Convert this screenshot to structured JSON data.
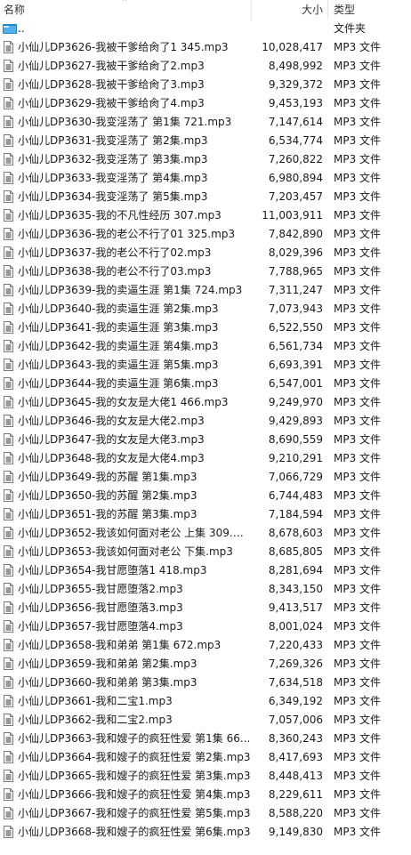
{
  "columns": {
    "name": "名称",
    "size": "大小",
    "type": "类型"
  },
  "parent": {
    "name": "..",
    "type": "文件夹",
    "icon": "folder-up-icon"
  },
  "file_icon": "mp3-file-icon",
  "files": [
    {
      "name": "小仙儿DP3626-我被干爹给肏了1 345.mp3",
      "size": "10,028,417",
      "type": "MP3 文件"
    },
    {
      "name": "小仙儿DP3627-我被干爹给肏了2.mp3",
      "size": "8,498,992",
      "type": "MP3 文件"
    },
    {
      "name": "小仙儿DP3628-我被干爹给肏了3.mp3",
      "size": "9,329,372",
      "type": "MP3 文件"
    },
    {
      "name": "小仙儿DP3629-我被干爹给肏了4.mp3",
      "size": "9,453,193",
      "type": "MP3 文件"
    },
    {
      "name": "小仙儿DP3630-我变淫荡了 第1集 721.mp3",
      "size": "7,147,614",
      "type": "MP3 文件"
    },
    {
      "name": "小仙儿DP3631-我变淫荡了 第2集.mp3",
      "size": "6,534,774",
      "type": "MP3 文件"
    },
    {
      "name": "小仙儿DP3632-我变淫荡了 第3集.mp3",
      "size": "7,260,822",
      "type": "MP3 文件"
    },
    {
      "name": "小仙儿DP3633-我变淫荡了 第4集.mp3",
      "size": "6,980,894",
      "type": "MP3 文件"
    },
    {
      "name": "小仙儿DP3634-我变淫荡了 第5集.mp3",
      "size": "7,203,457",
      "type": "MP3 文件"
    },
    {
      "name": "小仙儿DP3635-我的不凡性经历 307.mp3",
      "size": "11,003,911",
      "type": "MP3 文件"
    },
    {
      "name": "小仙儿DP3636-我的老公不行了01 325.mp3",
      "size": "7,842,890",
      "type": "MP3 文件"
    },
    {
      "name": "小仙儿DP3637-我的老公不行了02.mp3",
      "size": "8,029,396",
      "type": "MP3 文件"
    },
    {
      "name": "小仙儿DP3638-我的老公不行了03.mp3",
      "size": "7,788,965",
      "type": "MP3 文件"
    },
    {
      "name": "小仙儿DP3639-我的卖逼生涯 第1集 724.mp3",
      "size": "7,311,247",
      "type": "MP3 文件"
    },
    {
      "name": "小仙儿DP3640-我的卖逼生涯 第2集.mp3",
      "size": "7,073,943",
      "type": "MP3 文件"
    },
    {
      "name": "小仙儿DP3641-我的卖逼生涯 第3集.mp3",
      "size": "6,522,550",
      "type": "MP3 文件"
    },
    {
      "name": "小仙儿DP3642-我的卖逼生涯 第4集.mp3",
      "size": "6,561,734",
      "type": "MP3 文件"
    },
    {
      "name": "小仙儿DP3643-我的卖逼生涯 第5集.mp3",
      "size": "6,693,391",
      "type": "MP3 文件"
    },
    {
      "name": "小仙儿DP3644-我的卖逼生涯 第6集.mp3",
      "size": "6,547,001",
      "type": "MP3 文件"
    },
    {
      "name": "小仙儿DP3645-我的女友是大佬1 466.mp3",
      "size": "9,249,970",
      "type": "MP3 文件"
    },
    {
      "name": "小仙儿DP3646-我的女友是大佬2.mp3",
      "size": "9,429,893",
      "type": "MP3 文件"
    },
    {
      "name": "小仙儿DP3647-我的女友是大佬3.mp3",
      "size": "8,690,559",
      "type": "MP3 文件"
    },
    {
      "name": "小仙儿DP3648-我的女友是大佬4.mp3",
      "size": "9,210,291",
      "type": "MP3 文件"
    },
    {
      "name": "小仙儿DP3649-我的苏醒 第1集.mp3",
      "size": "7,066,729",
      "type": "MP3 文件"
    },
    {
      "name": "小仙儿DP3650-我的苏醒 第2集.mp3",
      "size": "6,744,483",
      "type": "MP3 文件"
    },
    {
      "name": "小仙儿DP3651-我的苏醒 第3集.mp3",
      "size": "7,184,594",
      "type": "MP3 文件"
    },
    {
      "name": "小仙儿DP3652-我该如何面对老公 上集 309.m...",
      "size": "8,678,603",
      "type": "MP3 文件"
    },
    {
      "name": "小仙儿DP3653-我该如何面对老公 下集.mp3",
      "size": "8,685,805",
      "type": "MP3 文件"
    },
    {
      "name": "小仙儿DP3654-我甘愿堕落1 418.mp3",
      "size": "8,281,694",
      "type": "MP3 文件"
    },
    {
      "name": "小仙儿DP3655-我甘愿堕落2.mp3",
      "size": "8,343,150",
      "type": "MP3 文件"
    },
    {
      "name": "小仙儿DP3656-我甘愿堕落3.mp3",
      "size": "9,413,517",
      "type": "MP3 文件"
    },
    {
      "name": "小仙儿DP3657-我甘愿堕落4.mp3",
      "size": "8,001,024",
      "type": "MP3 文件"
    },
    {
      "name": "小仙儿DP3658-我和弟弟 第1集 672.mp3",
      "size": "7,220,433",
      "type": "MP3 文件"
    },
    {
      "name": "小仙儿DP3659-我和弟弟 第2集.mp3",
      "size": "7,269,326",
      "type": "MP3 文件"
    },
    {
      "name": "小仙儿DP3660-我和弟弟 第3集.mp3",
      "size": "7,634,518",
      "type": "MP3 文件"
    },
    {
      "name": "小仙儿DP3661-我和二宝1.mp3",
      "size": "6,349,192",
      "type": "MP3 文件"
    },
    {
      "name": "小仙儿DP3662-我和二宝2.mp3",
      "size": "7,057,006",
      "type": "MP3 文件"
    },
    {
      "name": "小仙儿DP3663-我和嫂子的疯狂性爱 第1集 66...",
      "size": "8,360,243",
      "type": "MP3 文件"
    },
    {
      "name": "小仙儿DP3664-我和嫂子的疯狂性爱 第2集.mp3",
      "size": "8,417,693",
      "type": "MP3 文件"
    },
    {
      "name": "小仙儿DP3665-我和嫂子的疯狂性爱 第3集.mp3",
      "size": "8,448,413",
      "type": "MP3 文件"
    },
    {
      "name": "小仙儿DP3666-我和嫂子的疯狂性爱 第4集.mp3",
      "size": "8,229,611",
      "type": "MP3 文件"
    },
    {
      "name": "小仙儿DP3667-我和嫂子的疯狂性爱 第5集.mp3",
      "size": "8,588,220",
      "type": "MP3 文件"
    },
    {
      "name": "小仙儿DP3668-我和嫂子的疯狂性爱 第6集.mp3",
      "size": "9,149,830",
      "type": "MP3 文件"
    }
  ]
}
